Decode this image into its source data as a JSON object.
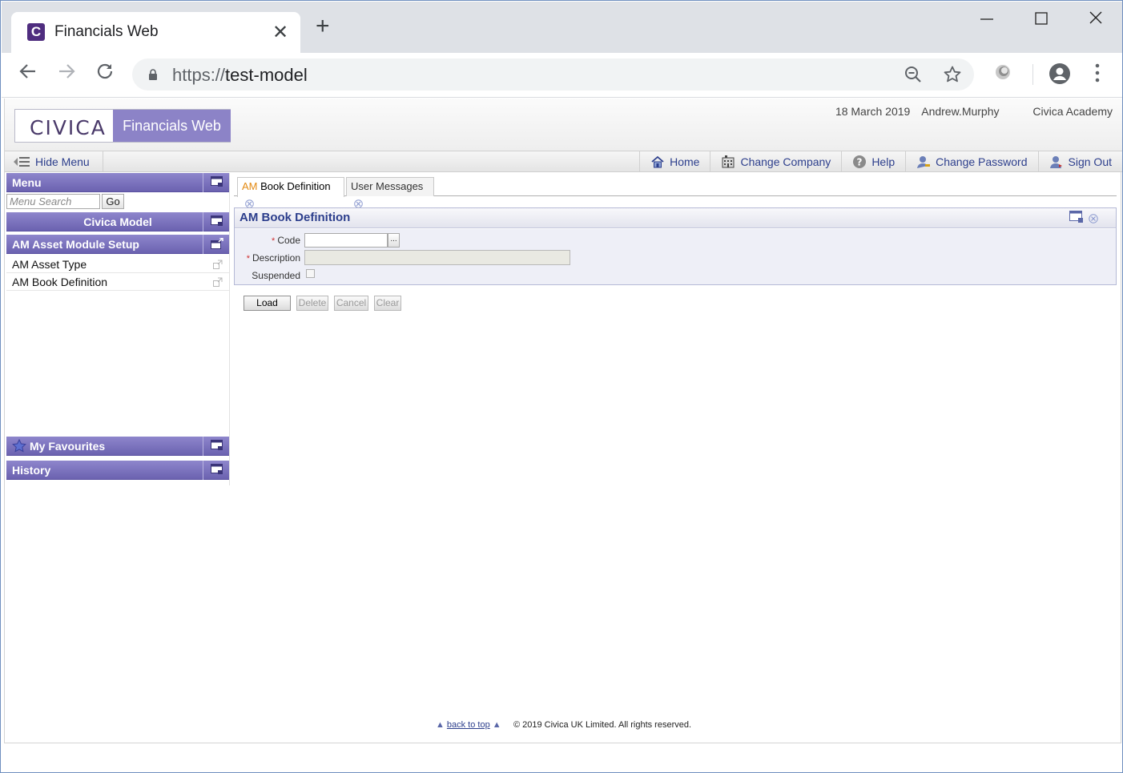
{
  "browser": {
    "tab_title": "Financials Web",
    "favicon_letter": "C",
    "url_scheme": "https://",
    "url_host": "test-model",
    "new_tab_glyph": "+",
    "close_glyph": "✕"
  },
  "header": {
    "logo_civica": "CIVICA",
    "logo_product": "Financials Web",
    "date": "18 March 2019",
    "user": "Andrew.Murphy",
    "organisation": "Civica Academy"
  },
  "nav": {
    "hide_menu": "Hide Menu",
    "links": [
      "Home",
      "Change Company",
      "Help",
      "Change Password",
      "Sign Out"
    ]
  },
  "sidebar": {
    "menu_title": "Menu",
    "search_placeholder": "Menu Search",
    "go_label": "Go",
    "root": "Civica Model",
    "section": "AM Asset Module Setup",
    "items": [
      "AM Asset Type",
      "AM Book Definition"
    ],
    "favourites": "My Favourites",
    "history": "History"
  },
  "tabs": {
    "active_prefix": "AM",
    "active_rest": "Book Definition",
    "second": "User Messages"
  },
  "form": {
    "title": "AM Book Definition",
    "required_mark": "*",
    "code_label": "Code",
    "description_label": "Description",
    "suspended_label": "Suspended",
    "lookup_label": "...",
    "code_value": "",
    "description_value": "",
    "suspended_checked": false
  },
  "actions": {
    "load": "Load",
    "delete": "Delete",
    "cancel": "Cancel",
    "clear": "Clear"
  },
  "footer": {
    "back_to_top": "back to top",
    "copyright": "© 2019 Civica UK Limited. All rights reserved."
  },
  "colors": {
    "panel_header": "#7a72bd",
    "logo_product_bg": "#8c83c7",
    "link": "#2c3e8c",
    "accent_orange": "#e38a13"
  }
}
